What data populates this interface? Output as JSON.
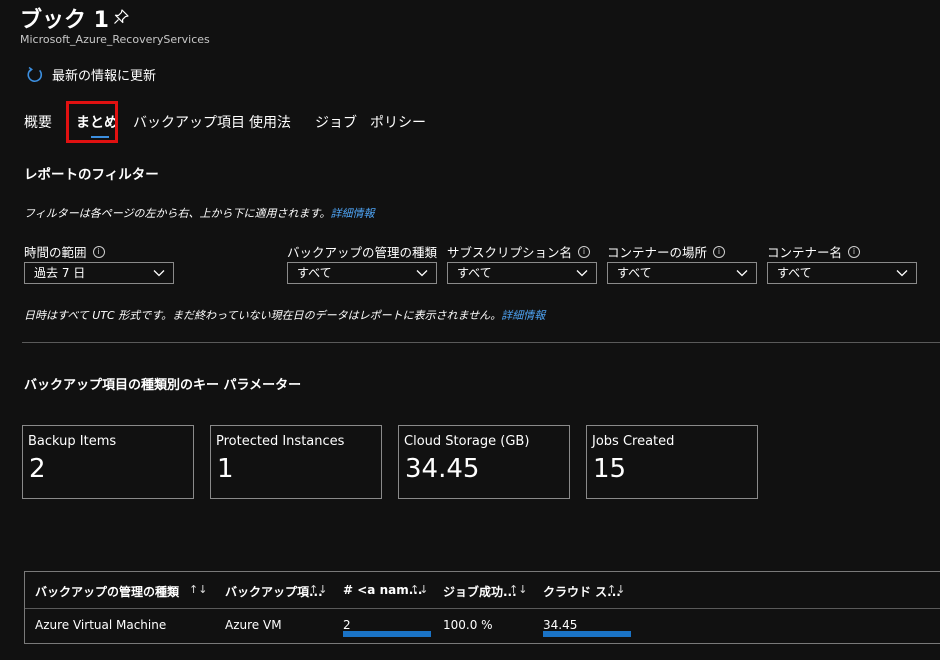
{
  "header": {
    "title": "ブック 1",
    "subtitle": "Microsoft_Azure_RecoveryServices",
    "refresh_label": "最新の情報に更新"
  },
  "tabs": [
    {
      "label": "概要",
      "active": false
    },
    {
      "label": "まとめ",
      "active": true
    },
    {
      "label": "バックアップ項目",
      "active": false
    },
    {
      "label": "使用法",
      "active": false
    },
    {
      "label": "ジョブ",
      "active": false
    },
    {
      "label": "ポリシー",
      "active": false
    }
  ],
  "filters_section": {
    "heading": "レポートのフィルター",
    "info_text": "フィルターは各ページの左から右、上から下に適用されます。",
    "info_link": "詳細情報",
    "filters": [
      {
        "label": "時間の範囲",
        "value": "過去 7 日"
      },
      {
        "label": "バックアップの管理の種類",
        "value": "すべて"
      },
      {
        "label": "サブスクリプション名",
        "value": "すべて"
      },
      {
        "label": "コンテナーの場所",
        "value": "すべて"
      },
      {
        "label": "コンテナー名",
        "value": "すべて"
      }
    ],
    "utc_text": "日時はすべて UTC 形式です。まだ終わっていない現在日のデータはレポートに表示されません。",
    "utc_link": "詳細情報"
  },
  "kpi_section": {
    "heading": "バックアップ項目の種類別のキー パラメーター",
    "cards": [
      {
        "label": "Backup Items",
        "value": "2"
      },
      {
        "label": "Protected Instances",
        "value": "1"
      },
      {
        "label": "Cloud Storage (GB)",
        "value": "34.45"
      },
      {
        "label": "Jobs Created",
        "value": "15"
      }
    ]
  },
  "table": {
    "columns": [
      "バックアップの管理の種類",
      "バックアップ項...",
      "# <a nam...",
      "ジョブ成功...",
      "クラウド ス..."
    ],
    "sort_icon": "↑↓",
    "rows": [
      {
        "management_type": "Azure Virtual Machine",
        "item_type": "Azure VM",
        "count": "2",
        "count_fraction": 1.0,
        "job_success": "100.0 %",
        "cloud_storage": "34.45",
        "cloud_storage_fraction": 1.0
      }
    ]
  },
  "colors": {
    "background": "#111111",
    "accent": "#3c8fe0",
    "link": "#4ea3f3",
    "highlight": "#e11111",
    "bar": "#1a73c6"
  }
}
